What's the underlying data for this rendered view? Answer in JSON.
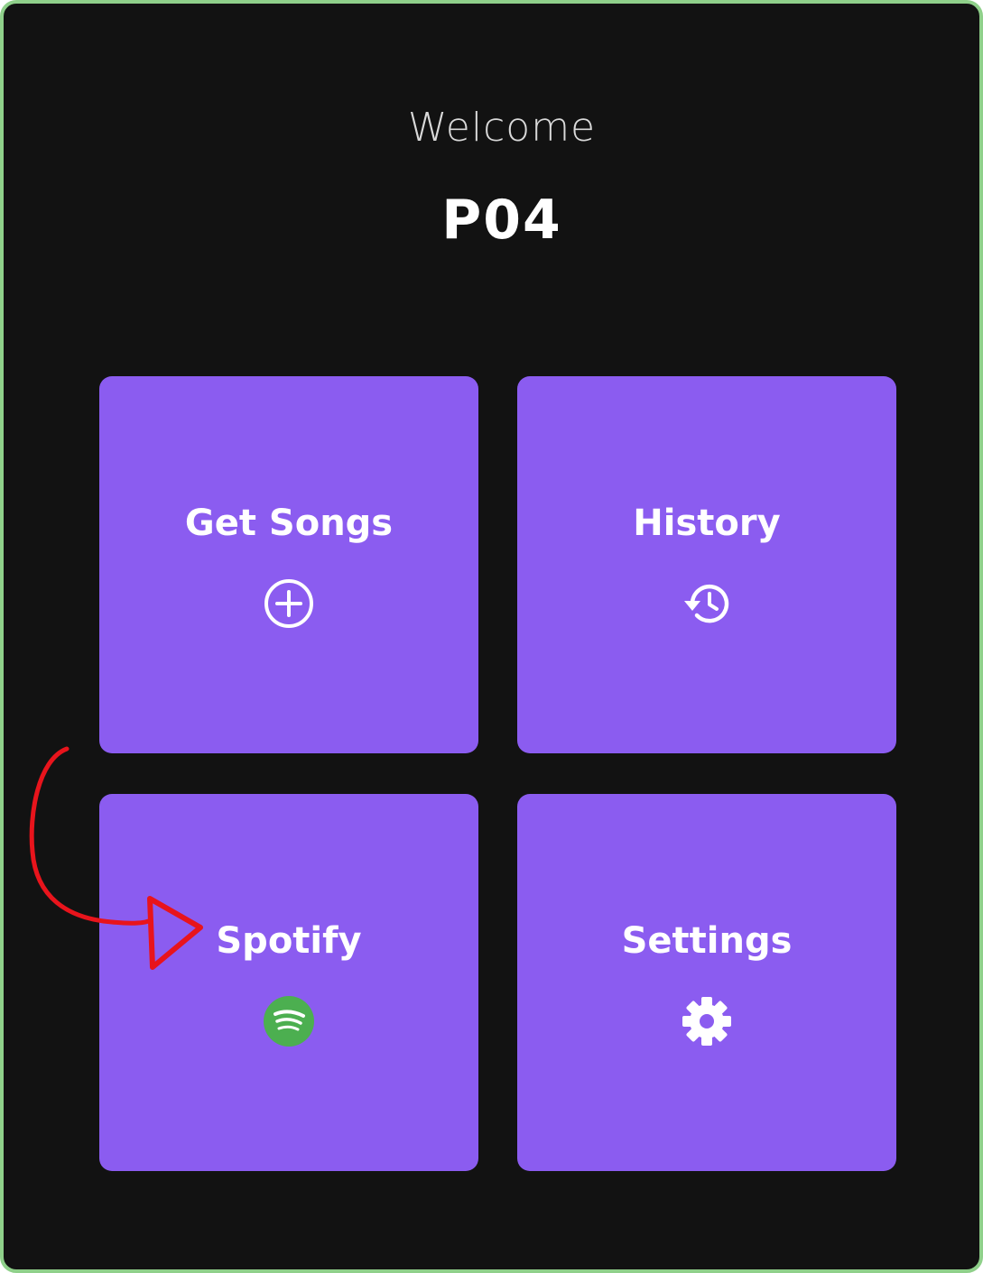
{
  "header": {
    "welcome_text": "Welcome",
    "user_name": "P04"
  },
  "tiles": [
    {
      "label": "Get Songs",
      "icon": "add-circle-icon"
    },
    {
      "label": "History",
      "icon": "history-icon"
    },
    {
      "label": "Spotify",
      "icon": "spotify-icon"
    },
    {
      "label": "Settings",
      "icon": "gear-icon"
    }
  ],
  "colors": {
    "background": "#121212",
    "tile": "#8b5cf0",
    "frame_border": "#8fd08a",
    "spotify_green": "#4caf50",
    "annotation_red": "#e8141c"
  }
}
